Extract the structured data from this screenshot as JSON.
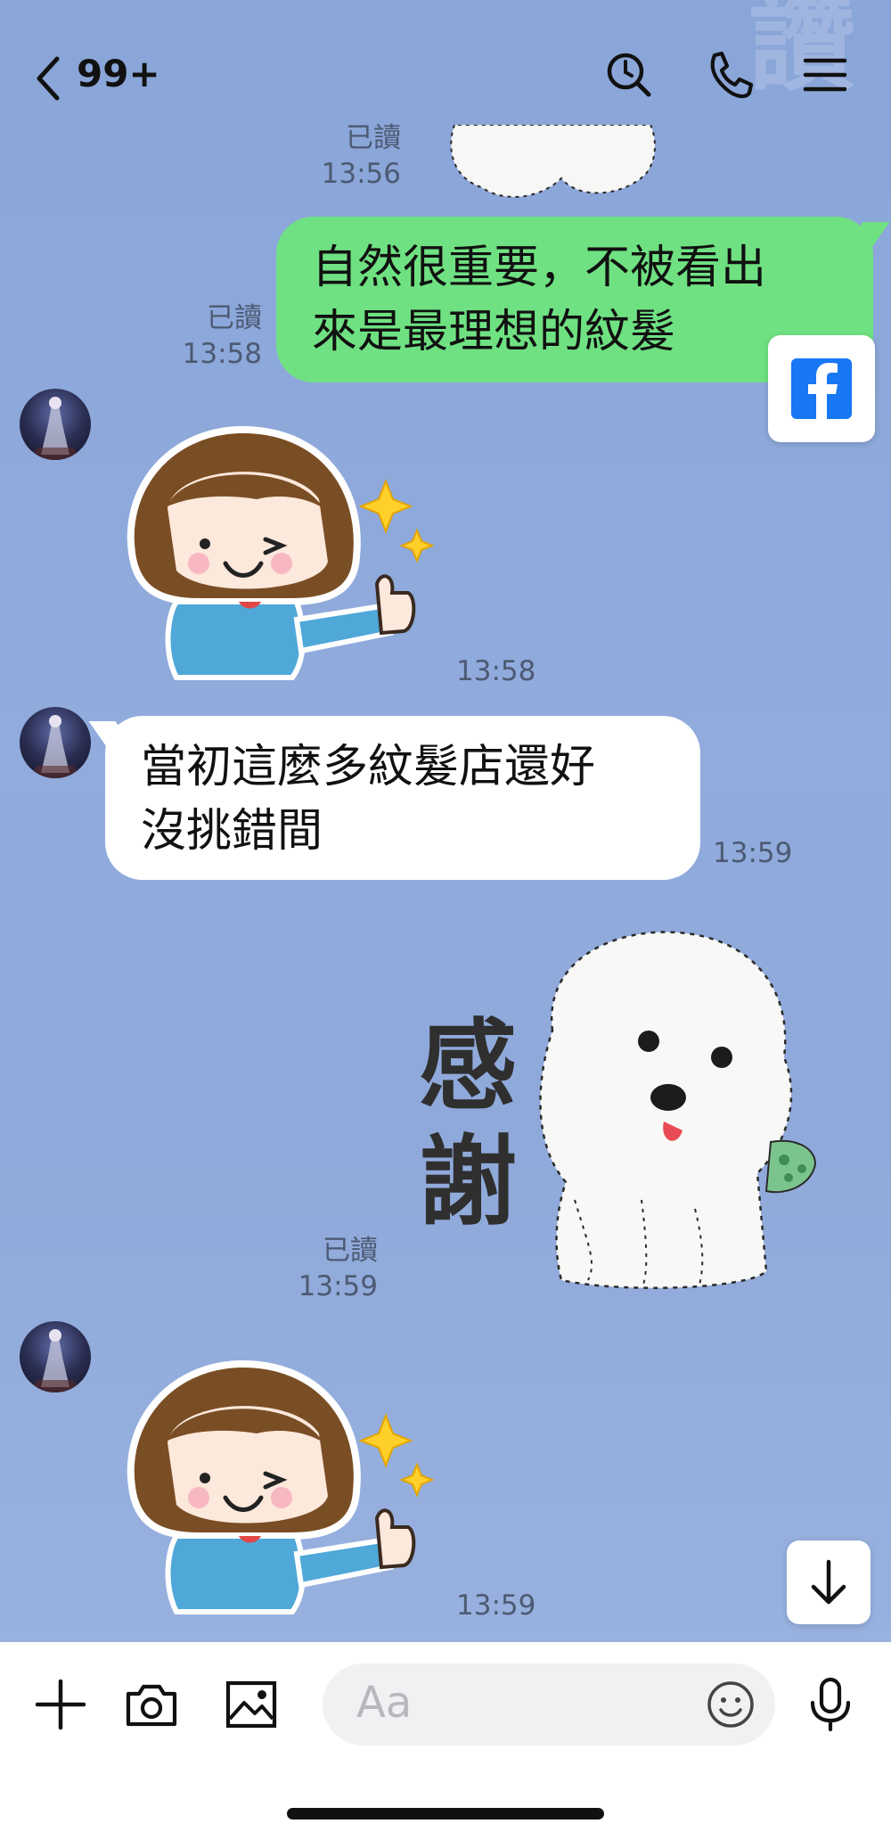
{
  "header": {
    "unread_count": "99+",
    "icons": [
      "chevron-left-icon",
      "search-icon",
      "phone-icon",
      "menu-icon"
    ]
  },
  "watermark": "讚",
  "messages": [
    {
      "type": "sticker",
      "side": "out",
      "sticker": "white-dog",
      "read": "已讀",
      "time": "13:56"
    },
    {
      "type": "text",
      "side": "out",
      "text_line1": "自然很重要，不被看出",
      "text_line2": "來是最理想的紋髮",
      "read": "已讀",
      "time": "13:58"
    },
    {
      "type": "sticker",
      "side": "in",
      "sticker": "girl-thumbs-up",
      "time": "13:58"
    },
    {
      "type": "text",
      "side": "in",
      "text_line1": "當初這麼多紋髮店還好",
      "text_line2": "沒挑錯間",
      "time": "13:59"
    },
    {
      "type": "sticker",
      "side": "out",
      "sticker": "dog-thanks",
      "sticker_text_1": "感",
      "sticker_text_2": "謝",
      "read": "已讀",
      "time": "13:59"
    },
    {
      "type": "sticker",
      "side": "in",
      "sticker": "girl-thumbs-up",
      "time": "13:59"
    }
  ],
  "input": {
    "placeholder": "Aa",
    "icons": [
      "plus-icon",
      "camera-icon",
      "image-icon",
      "emoji-icon",
      "microphone-icon"
    ]
  },
  "colors": {
    "background": "#8ea8da",
    "outgoing_bubble": "#6fe182",
    "incoming_bubble": "#ffffff",
    "facebook_blue": "#1877f2"
  }
}
